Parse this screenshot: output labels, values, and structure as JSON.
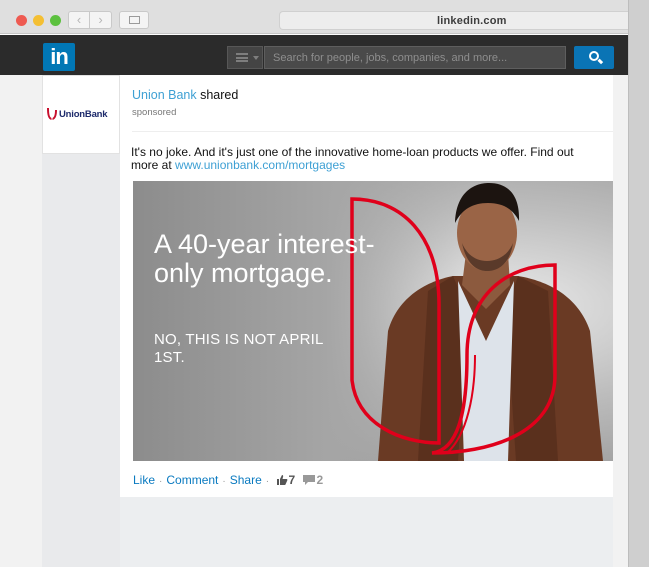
{
  "browser": {
    "address": "linkedin.com",
    "back_glyph": "‹",
    "forward_glyph": "›"
  },
  "header": {
    "logo": "in",
    "search_placeholder": "Search for people, jobs, companies, and more..."
  },
  "company": {
    "logo_name": "UnionBank",
    "brand_color": "#c8102e"
  },
  "post": {
    "actor_name": "Union Bank",
    "actor_action": "shared",
    "sponsored_label": "sponsored",
    "body_text": "It's no joke. And it's just one of the innovative home-loan products we offer. Find out more at",
    "body_link": "www.unionbank.com/mortgages",
    "ad": {
      "headline": "A 40-year interest-only mortgage.",
      "subline": "NO, THIS IS NOT APRIL 1ST."
    },
    "actions": {
      "like": "Like",
      "comment": "Comment",
      "share": "Share",
      "separator": "·",
      "like_count": "7",
      "comment_count": "2"
    }
  },
  "colors": {
    "linkedin_blue": "#0177b5",
    "link_blue": "#3ea0d4",
    "header_dark": "#2b2b2b",
    "ad_outline_red": "#e0001b"
  },
  "icons": [
    "back-arrow-icon",
    "forward-arrow-icon",
    "sidebar-toggle-icon",
    "search-type-icon",
    "search-icon",
    "thumbs-up-icon",
    "comment-icon"
  ]
}
